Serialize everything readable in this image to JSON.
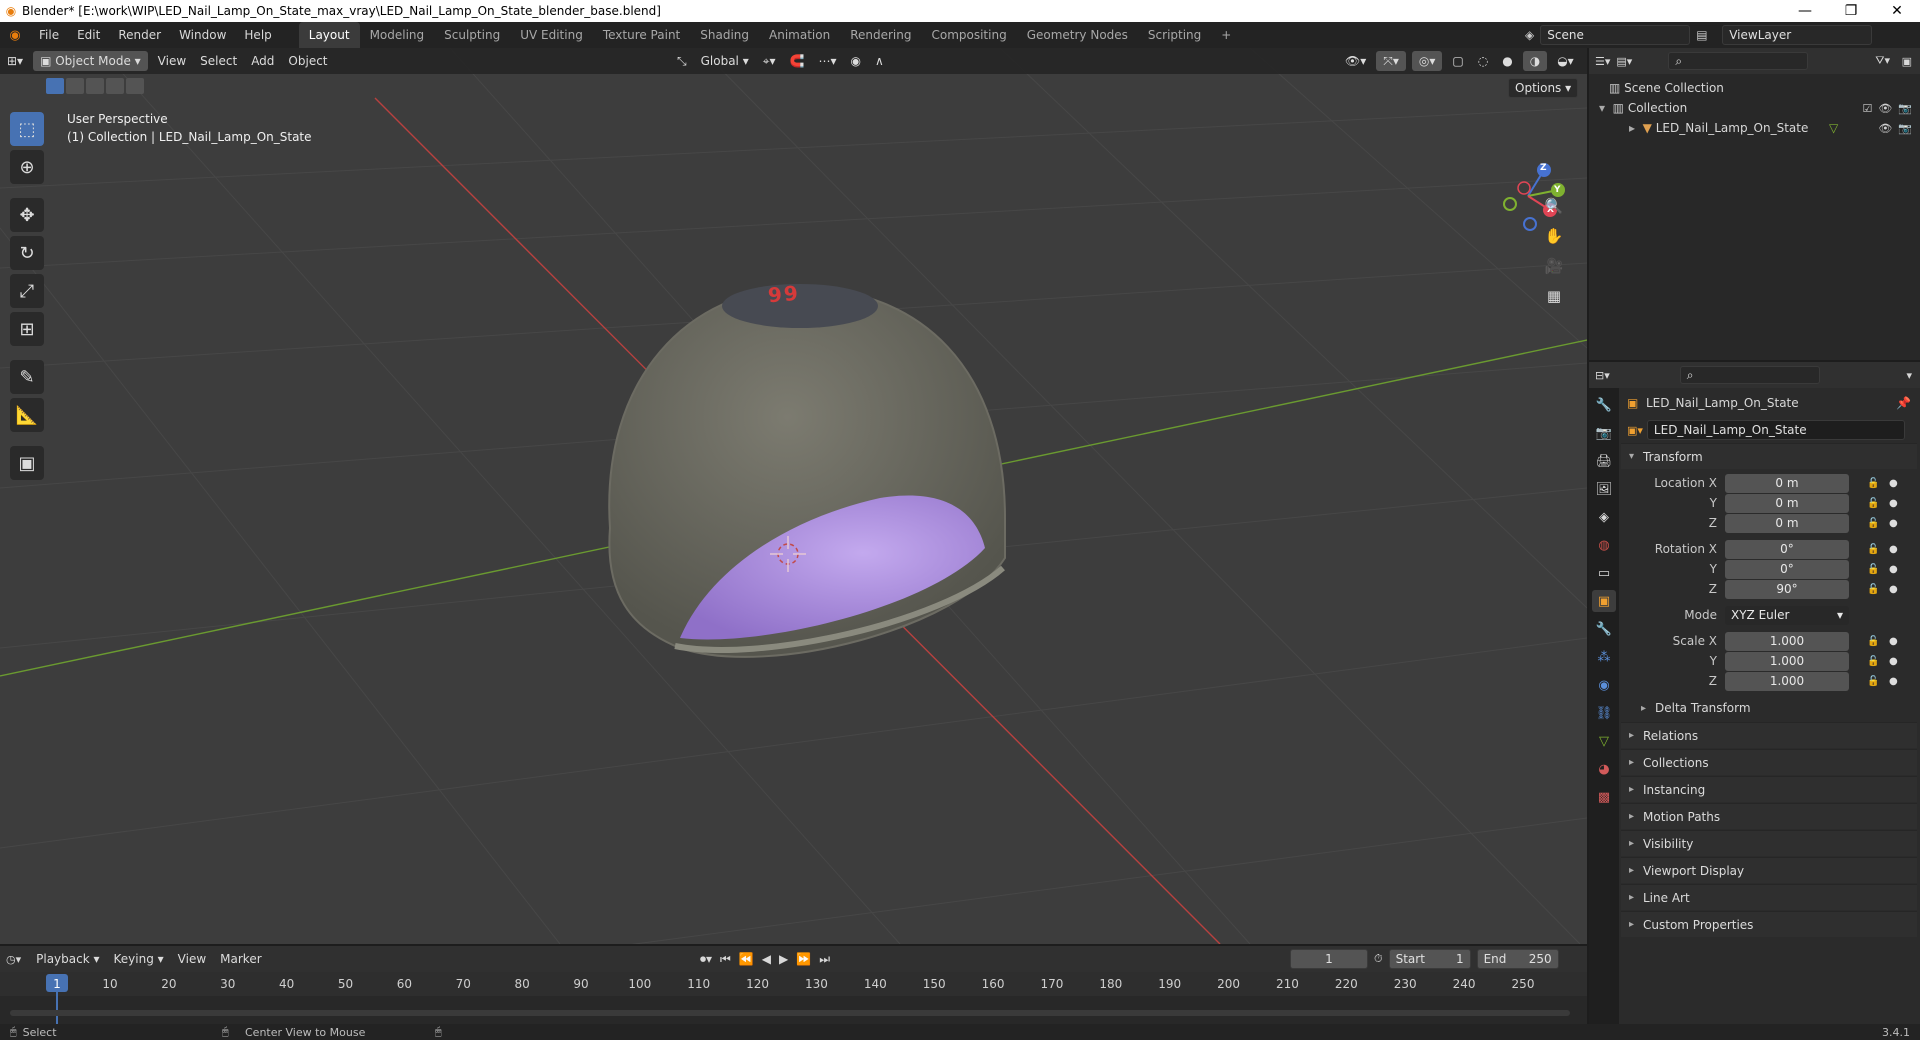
{
  "window": {
    "title": "Blender* [E:\\work\\WIP\\LED_Nail_Lamp_On_State_max_vray\\LED_Nail_Lamp_On_State_blender_base.blend]",
    "controls": [
      "—",
      "❐",
      "✕"
    ]
  },
  "menu": [
    "File",
    "Edit",
    "Render",
    "Window",
    "Help"
  ],
  "workspaces": [
    "Layout",
    "Modeling",
    "Sculpting",
    "UV Editing",
    "Texture Paint",
    "Shading",
    "Animation",
    "Rendering",
    "Compositing",
    "Geometry Nodes",
    "Scripting"
  ],
  "workspace_add": "+",
  "scene": {
    "name": "Scene",
    "view_layer": "ViewLayer"
  },
  "viewport": {
    "mode": "Object Mode",
    "menus": [
      "View",
      "Select",
      "Add",
      "Object"
    ],
    "orientation": "Global",
    "options_label": "Options",
    "perspective_label": "User Perspective",
    "collection_label": "(1) Collection | LED_Nail_Lamp_On_State",
    "display_number": "99",
    "gizmo_axes": [
      "X",
      "Y",
      "Z"
    ]
  },
  "outliner": {
    "scene_collection": "Scene Collection",
    "collection": "Collection",
    "object": "LED_Nail_Lamp_On_State"
  },
  "properties": {
    "object_name": "LED_Nail_Lamp_On_State",
    "data_name": "LED_Nail_Lamp_On_State",
    "transform_label": "Transform",
    "location": {
      "label": "Location X",
      "x": "0 m",
      "y": "0 m",
      "z": "0 m"
    },
    "rotation": {
      "label": "Rotation X",
      "x": "0°",
      "y": "0°",
      "z": "90°"
    },
    "axis_y": "Y",
    "axis_z": "Z",
    "mode_label": "Mode",
    "mode_value": "XYZ Euler",
    "scale": {
      "label": "Scale X",
      "x": "1.000",
      "y": "1.000",
      "z": "1.000"
    },
    "delta_transform": "Delta Transform",
    "panels": [
      "Relations",
      "Collections",
      "Instancing",
      "Motion Paths",
      "Visibility",
      "Viewport Display",
      "Line Art",
      "Custom Properties"
    ]
  },
  "timeline": {
    "menus": [
      "Playback",
      "Keying",
      "View",
      "Marker"
    ],
    "current_frame": "1",
    "start_label": "Start",
    "start_value": "1",
    "end_label": "End",
    "end_value": "250",
    "ticks": [
      "1",
      "10",
      "20",
      "30",
      "40",
      "50",
      "60",
      "70",
      "80",
      "90",
      "100",
      "110",
      "120",
      "130",
      "140",
      "150",
      "160",
      "170",
      "180",
      "190",
      "200",
      "210",
      "220",
      "230",
      "240",
      "250"
    ]
  },
  "statusbar": {
    "select": "Select",
    "center_view": "Center View to Mouse",
    "version": "3.4.1"
  }
}
